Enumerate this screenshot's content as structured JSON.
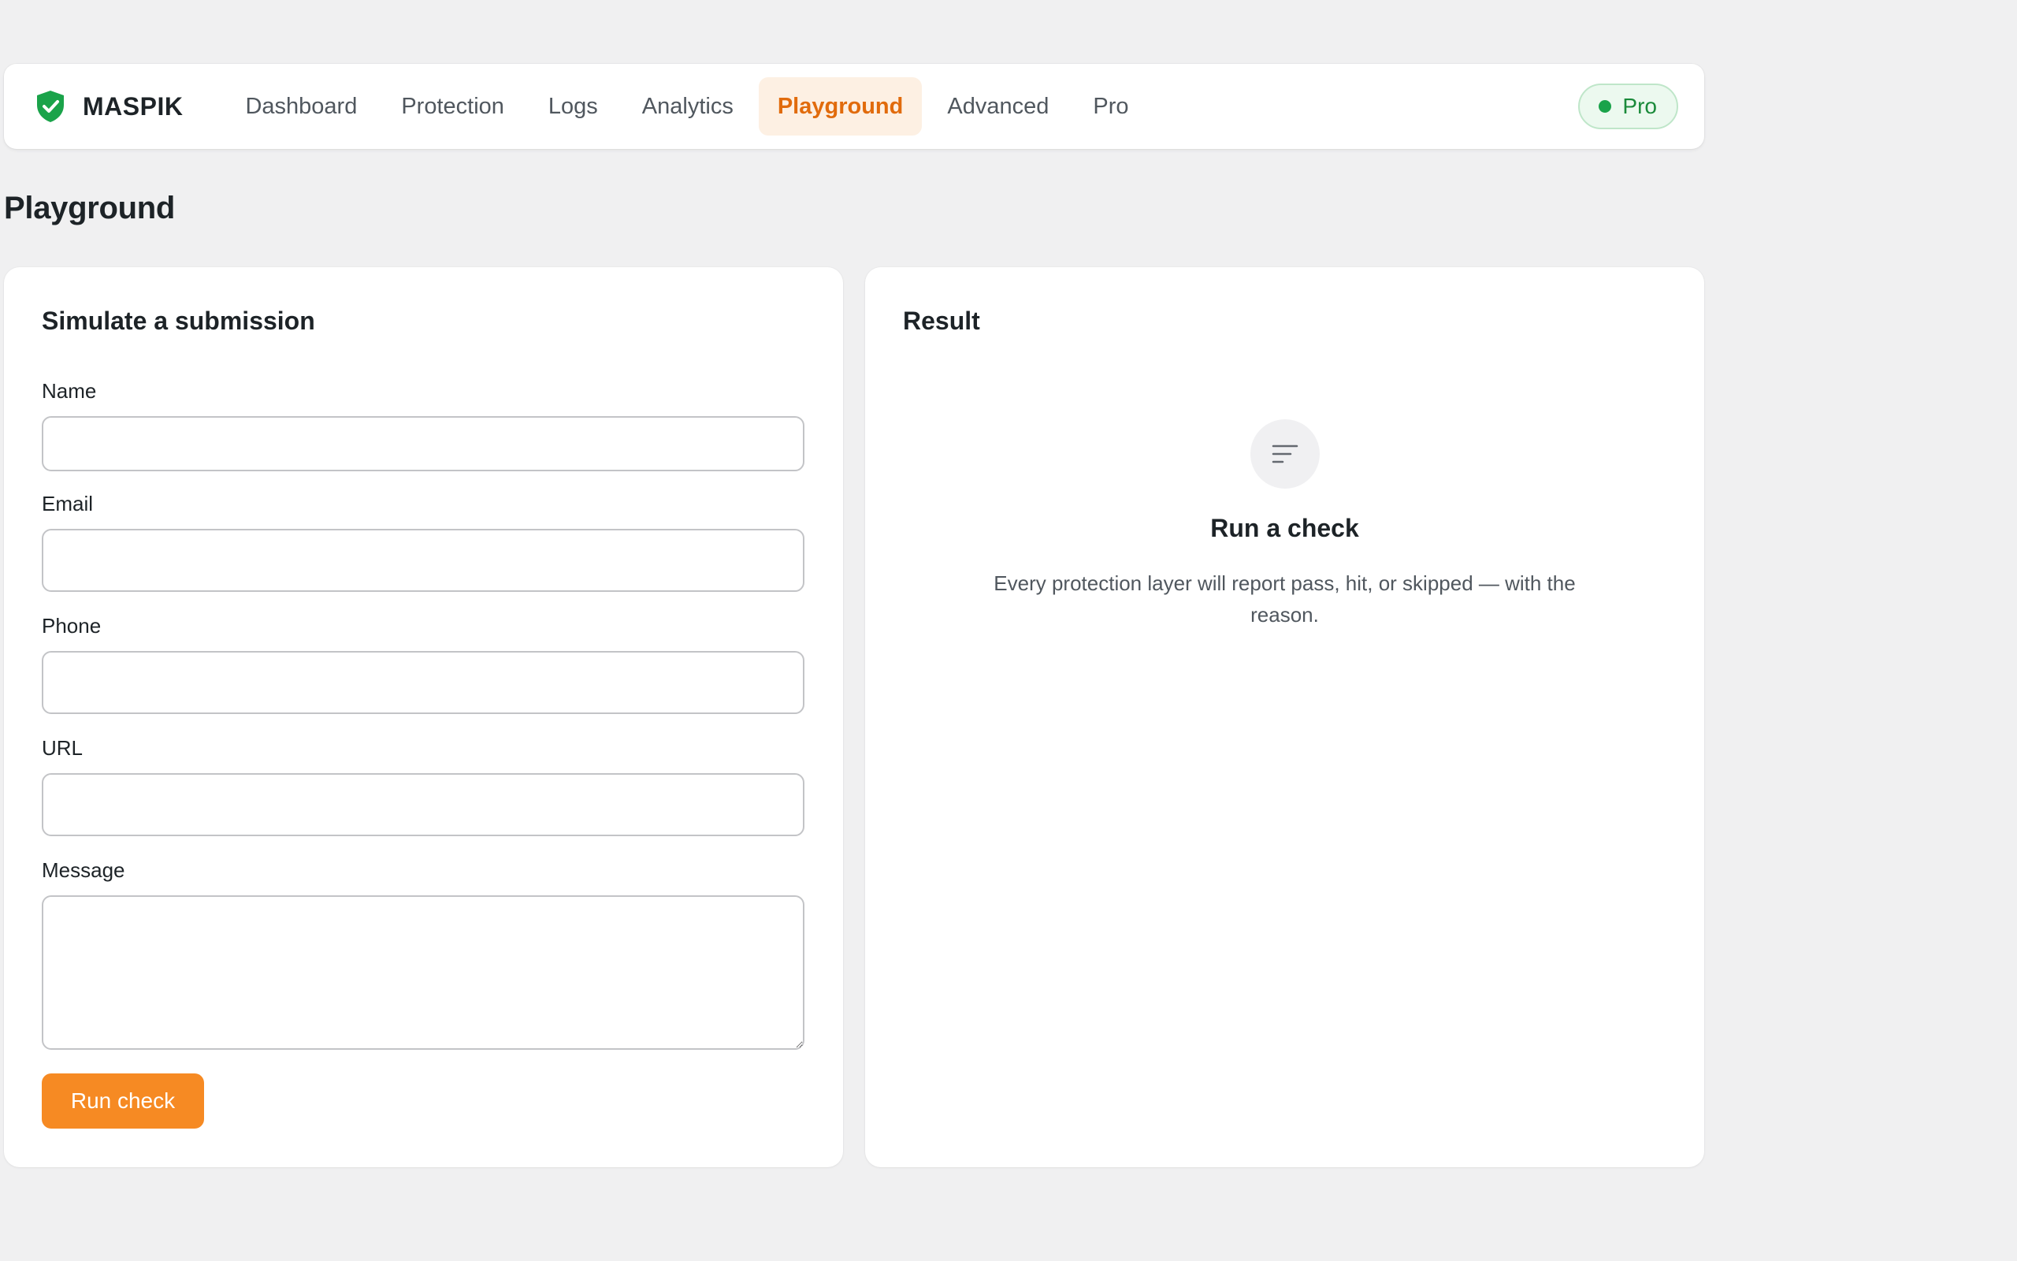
{
  "brand": {
    "name": "MASPIK",
    "logo_icon": "shield-check-icon",
    "logo_color": "#1aa34a"
  },
  "nav": {
    "items": [
      {
        "label": "Dashboard",
        "active": false
      },
      {
        "label": "Protection",
        "active": false
      },
      {
        "label": "Logs",
        "active": false
      },
      {
        "label": "Analytics",
        "active": false
      },
      {
        "label": "Playground",
        "active": true
      },
      {
        "label": "Advanced",
        "active": false
      },
      {
        "label": "Pro",
        "active": false
      }
    ],
    "plan_badge": {
      "label": "Pro",
      "status_color": "#1aa34a"
    }
  },
  "page": {
    "title": "Playground"
  },
  "simulate": {
    "title": "Simulate a submission",
    "fields": {
      "name": {
        "label": "Name",
        "value": ""
      },
      "email": {
        "label": "Email",
        "value": ""
      },
      "phone": {
        "label": "Phone",
        "value": ""
      },
      "url": {
        "label": "URL",
        "value": ""
      },
      "message": {
        "label": "Message",
        "value": ""
      }
    },
    "submit_label": "Run check",
    "accent_color": "#f68a23"
  },
  "result": {
    "title": "Result",
    "empty_icon": "lines-icon",
    "empty_title": "Run a check",
    "empty_description": "Every protection layer will report pass, hit, or skipped — with the reason."
  }
}
